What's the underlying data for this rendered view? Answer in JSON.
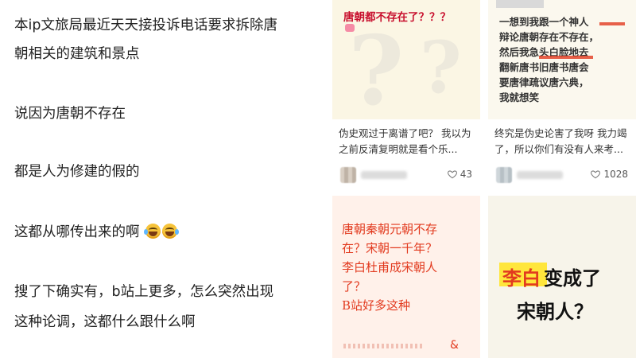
{
  "post": {
    "lines": [
      "本ip文旅局最近天天接投诉电话要求拆除唐",
      "朝相关的建筑和景点",
      "说因为唐朝不存在",
      "都是人为修建的假的",
      "这都从哪传出来的啊",
      "搜了下确实有，b站上更多，怎么突然出现",
      "这种论调，这都什么跟什么啊"
    ]
  },
  "cards": [
    {
      "image_text": "唐朝都不存在了？？？",
      "caption": "伪史观过于离谱了吧？ 我以为之前反清复明就是看个乐...",
      "likes": "43"
    },
    {
      "image_text": "一想到我跟一个神人辩论唐朝存在不存在，然后我急头白脸地去翻新唐书旧唐书唐会要唐律疏议唐六典，我就想笑",
      "image_lines": [
        "一想到我跟一个神人",
        "辩论唐朝存在不存在，",
        "然后我急头白脸地去",
        "翻新唐书旧唐书唐会",
        "要唐律疏议唐六典，",
        "我就想笑"
      ],
      "caption": "终究是伪史论害了我呀 我力竭了，所以你们有没有人来考...",
      "likes": "1028"
    },
    {
      "image_lines": [
        "唐朝秦朝元朝不存",
        "在？宋朝一千年？",
        "李白杜甫成宋朝人",
        "了？",
        "B站好多这种"
      ],
      "symbol": "&"
    },
    {
      "image_line1_a": "李白",
      "image_line1_b": "变成了",
      "image_line2": "宋朝人？"
    }
  ],
  "colors": {
    "red_text": "#c8102e",
    "orange_red": "#e23a1f",
    "card3_bg": "#fff1ea",
    "card1_bg": "#fbf6e4",
    "card2_bg": "#fbf8ee",
    "card4_bg": "#f7f4ea",
    "marker_yellow": "#ffe63c"
  },
  "icons": [
    "heart-icon",
    "laughing-emoji-icon"
  ]
}
